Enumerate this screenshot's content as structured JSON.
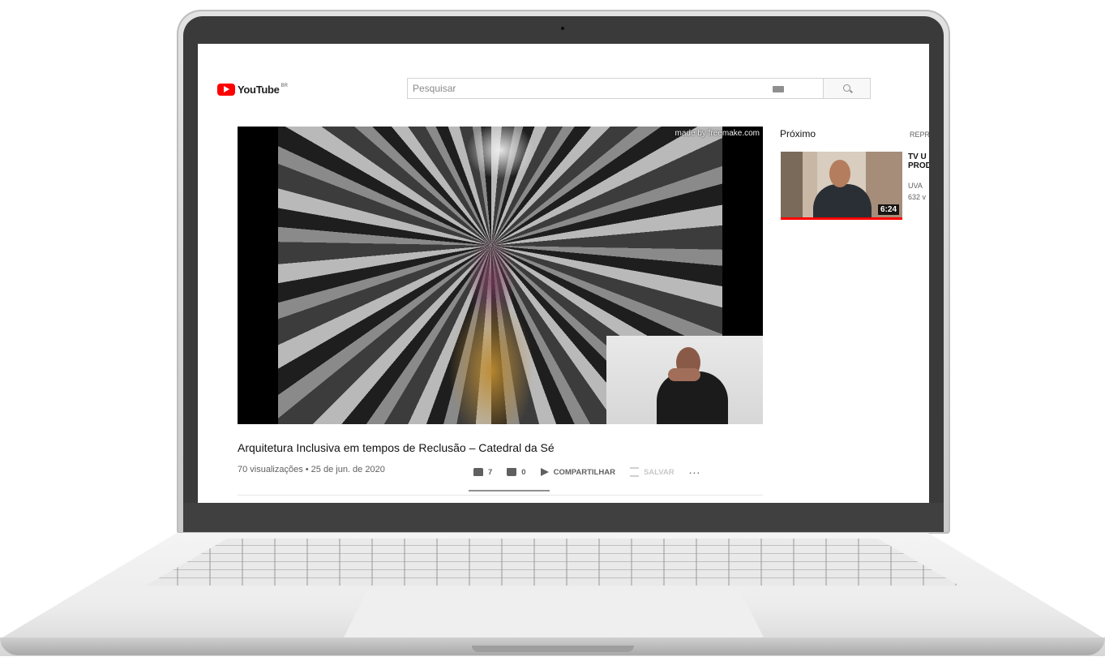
{
  "header": {
    "logo_text": "YouTube",
    "region": "BR",
    "search_placeholder": "Pesquisar"
  },
  "player": {
    "watermark": "made by freemake.com"
  },
  "video": {
    "title": "Arquitetura Inclusiva em tempos de Reclusão – Catedral da Sé",
    "meta": "70 visualizações • 25 de jun. de 2020",
    "likes": "7",
    "dislikes": "0",
    "share_label": "COMPARTILHAR",
    "save_label": "SALVAR",
    "more_label": "..."
  },
  "sidebar": {
    "up_next": "Próximo",
    "autoplay_label": "REPR",
    "items": [
      {
        "title_line1": "TV U",
        "title_line2": "PROD",
        "channel": "UVA",
        "views": "632 v",
        "duration": "6:24"
      }
    ]
  },
  "colors": {
    "brand_red": "#ff0000",
    "text_primary": "#111111",
    "text_secondary": "#606060"
  }
}
